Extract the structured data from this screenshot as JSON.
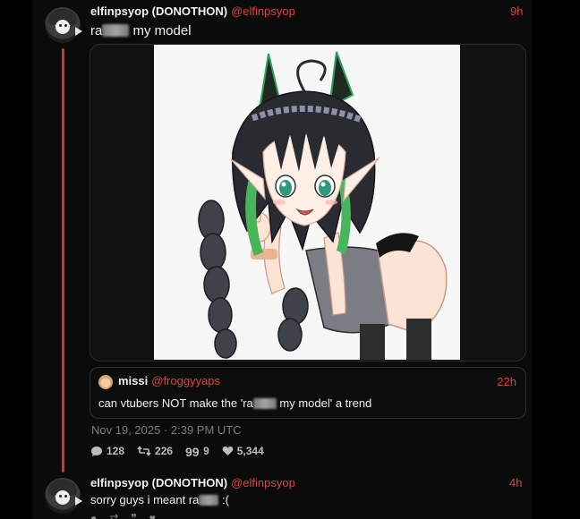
{
  "colors": {
    "accent": "#d8453b",
    "thread_line": "#c8372d",
    "background": "#0b0b0b",
    "muted_text": "#7d7d7d"
  },
  "post": {
    "display_name": "elfinpsyop (DONOTHON)",
    "handle": "@elfinpsyop",
    "time": "9h",
    "text_before": "ra",
    "text_after": " my model",
    "media": "anime-vtuber-model-artwork",
    "quote": {
      "display_name": "missi",
      "handle": "@froggyyaps",
      "time": "22h",
      "text_before": "can vtubers NOT make the 'ra",
      "text_after": " my model' a trend"
    },
    "date": "Nov 19, 2025 · 2:39 PM UTC",
    "stats": {
      "replies": "128",
      "reposts": "226",
      "quotes": "9",
      "likes": "5,344"
    },
    "icons": {
      "replies": "comment-icon",
      "reposts": "repost-icon",
      "quotes": "quote-icon",
      "likes": "heart-icon"
    }
  },
  "reply": {
    "display_name": "elfinpsyop (DONOTHON)",
    "handle": "@elfinpsyop",
    "time": "4h",
    "text_before": "sorry guys i meant ra",
    "text_after": " :("
  }
}
